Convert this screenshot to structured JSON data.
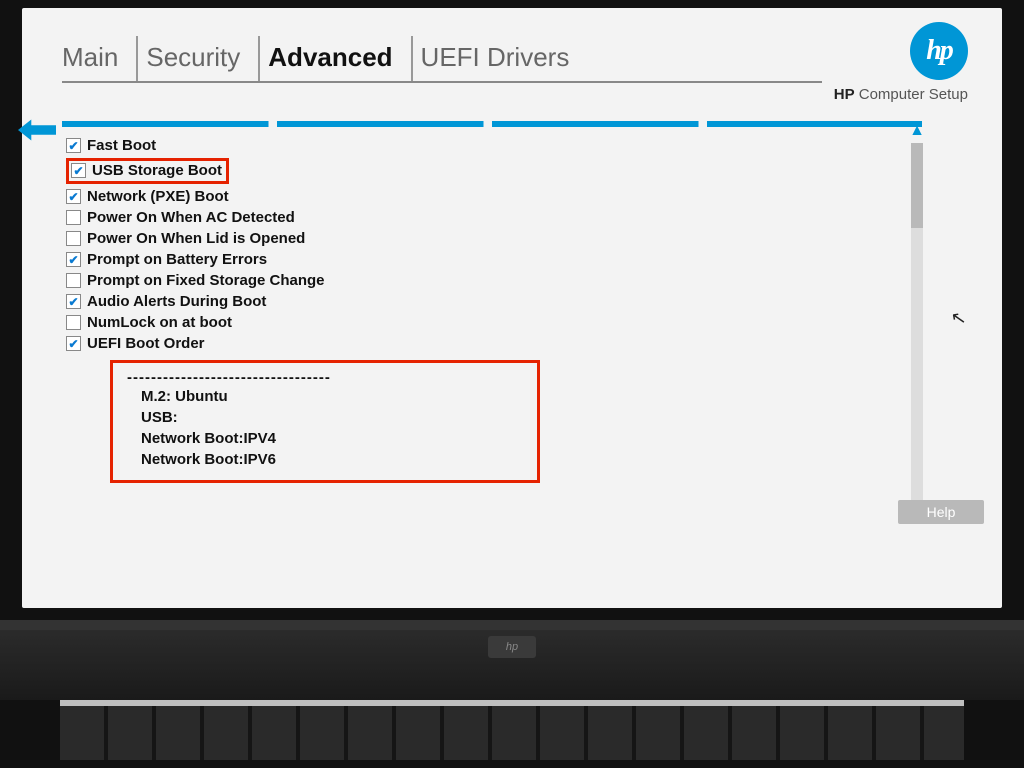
{
  "branding": {
    "logo_text": "hp",
    "subtitle_prefix": "HP",
    "subtitle_rest": " Computer Setup"
  },
  "tabs": {
    "items": [
      {
        "label": "Main"
      },
      {
        "label": "Security"
      },
      {
        "label": "Advanced"
      },
      {
        "label": "UEFI Drivers"
      }
    ],
    "active_index": 2
  },
  "options": [
    {
      "label": "Fast Boot",
      "checked": true,
      "highlighted": false
    },
    {
      "label": "USB Storage Boot",
      "checked": true,
      "highlighted": true
    },
    {
      "label": "Network (PXE) Boot",
      "checked": true,
      "highlighted": false
    },
    {
      "label": "Power On When AC Detected",
      "checked": false,
      "highlighted": false
    },
    {
      "label": "Power On When Lid is Opened",
      "checked": false,
      "highlighted": false
    },
    {
      "label": "Prompt on Battery Errors",
      "checked": true,
      "highlighted": false
    },
    {
      "label": "Prompt on Fixed Storage Change",
      "checked": false,
      "highlighted": false
    },
    {
      "label": "Audio Alerts During Boot",
      "checked": true,
      "highlighted": false
    },
    {
      "label": "NumLock on at boot",
      "checked": false,
      "highlighted": false
    },
    {
      "label": "UEFI Boot Order",
      "checked": true,
      "highlighted": false
    }
  ],
  "boot_order": {
    "separator": "----------------------------------",
    "entries": [
      "M.2:  Ubuntu",
      "USB:",
      "Network Boot:IPV4",
      "Network Boot:IPV6"
    ]
  },
  "help_label": "Help"
}
